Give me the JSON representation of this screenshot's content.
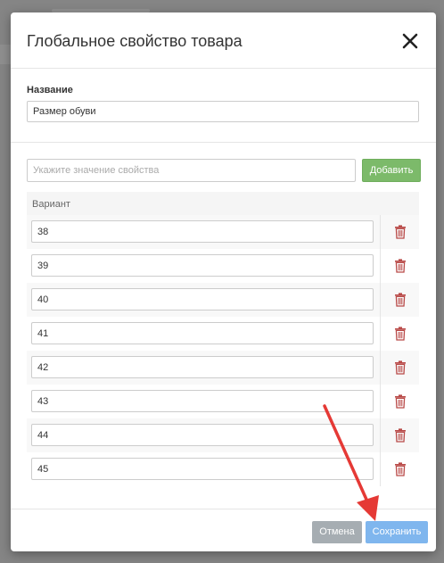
{
  "modal": {
    "title": "Глобальное свойство товара",
    "close_icon": "close-icon"
  },
  "name_section": {
    "label": "Название",
    "value": "Размер обуви"
  },
  "add_value": {
    "placeholder": "Укажите значение свойства",
    "button_label": "Добавить",
    "button_color": "#7cba6a"
  },
  "variants": {
    "header": "Вариант",
    "rows": [
      {
        "value": "38"
      },
      {
        "value": "39"
      },
      {
        "value": "40"
      },
      {
        "value": "41"
      },
      {
        "value": "42"
      },
      {
        "value": "43"
      },
      {
        "value": "44"
      },
      {
        "value": "45"
      }
    ],
    "delete_icon": "trash-icon",
    "delete_color": "#b94a48"
  },
  "footer": {
    "cancel_label": "Отмена",
    "save_label": "Сохранить",
    "save_color": "#7fb6ee",
    "cancel_color": "#a6adb2"
  },
  "annotation": {
    "arrow_icon": "red-arrow-icon",
    "color": "#e53935"
  }
}
